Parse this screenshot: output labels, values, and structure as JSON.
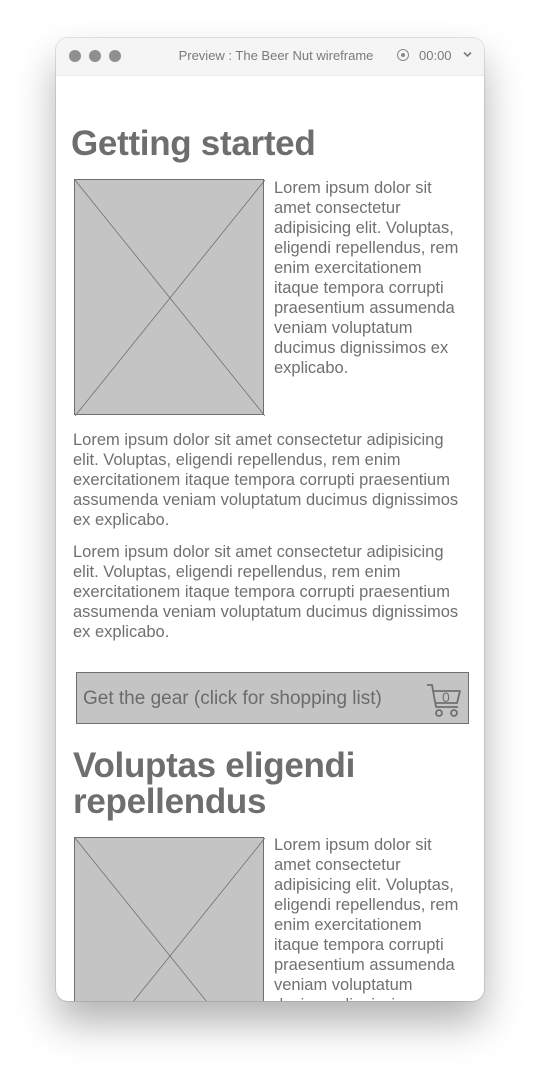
{
  "window": {
    "title": "Preview : The Beer Nut wireframe",
    "timer": "00:00"
  },
  "section1": {
    "heading": "Getting started",
    "float_text": "Lorem ipsum dolor sit amet consectetur adipisicing elit. Voluptas, eligendi repellendus, rem enim exercitationem itaque tempora corrupti praesentium assumenda veniam voluptatum ducimus dignissimos ex explicabo.",
    "paragraphs": [
      "Lorem ipsum dolor sit amet consectetur adipisicing elit. Voluptas, eligendi repellendus, rem enim exercitationem itaque tempora corrupti praesentium assumenda veniam voluptatum ducimus dignissimos ex explicabo.",
      "Lorem ipsum dolor sit amet consectetur adipisicing elit. Voluptas, eligendi repellendus, rem enim exercitationem itaque tempora corrupti praesentium assumenda veniam voluptatum ducimus dignissimos ex explicabo."
    ]
  },
  "gear_button": {
    "label": "Get the gear (click for shopping list)",
    "cart_count": "0",
    "icon": "shopping-cart-icon"
  },
  "section2": {
    "heading": "Voluptas eligendi repellendus",
    "float_text": "Lorem ipsum dolor sit amet consectetur adipisicing elit. Voluptas, eligendi repellendus, rem enim exercitationem itaque tempora corrupti praesentium assumenda veniam voluptatum ducimus dignissimos ex explicabo."
  },
  "colors": {
    "placeholder_fill": "#c4c4c4",
    "text": "#707070"
  }
}
